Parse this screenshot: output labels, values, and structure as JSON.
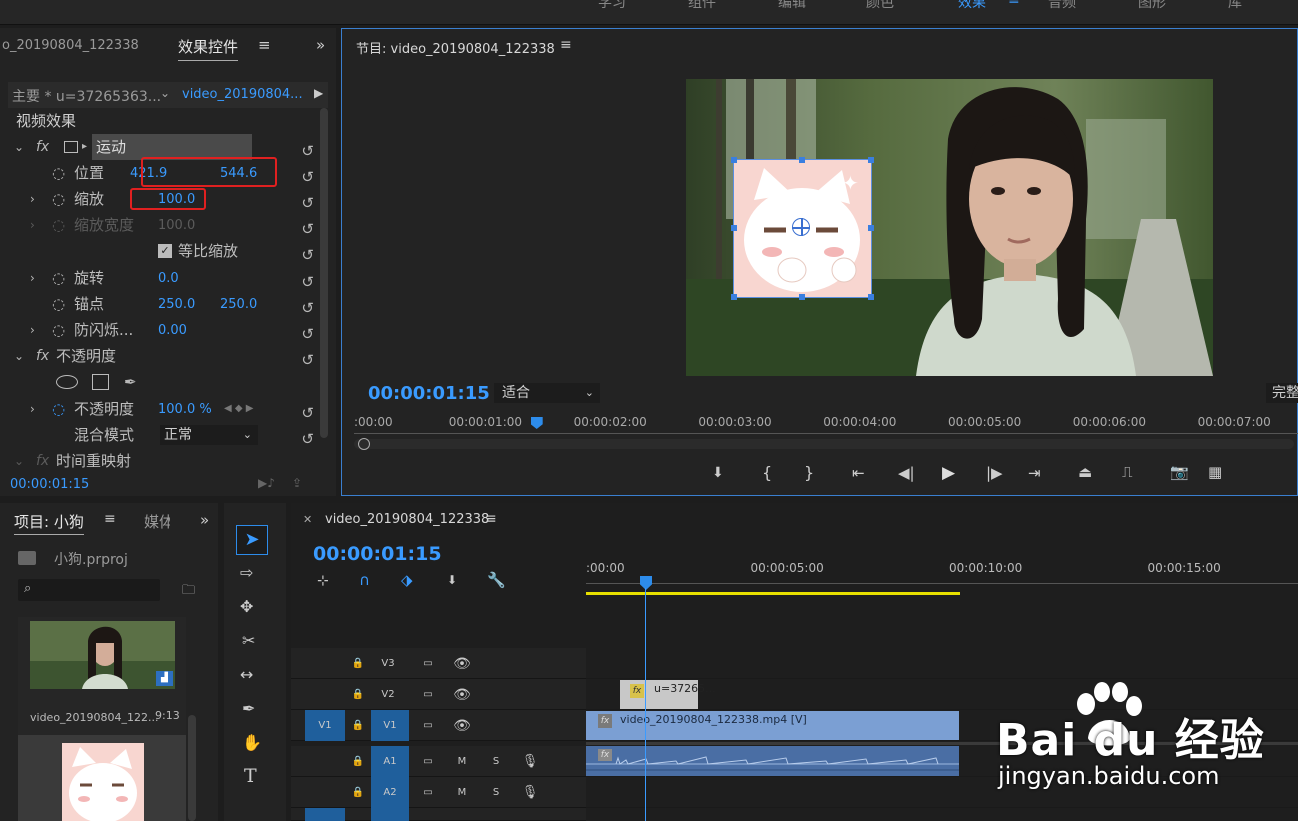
{
  "workspace_tabs": [
    "学习",
    "组件",
    "编辑",
    "颜色",
    "效果",
    "音频",
    "图形",
    "库"
  ],
  "active_workspace": "效果",
  "effect_controls": {
    "left_tab": "o_20190804_122338",
    "title": "效果控件",
    "source": "主要 * u=37265363...",
    "clip": "video_20190804...",
    "section_video": "视频效果",
    "motion": "运动",
    "position_label": "位置",
    "position_x": "421.9",
    "position_y": "544.6",
    "scale_label": "缩放",
    "scale_value": "100.0",
    "scale_width_label": "缩放宽度",
    "scale_width_value": "100.0",
    "uniform_label": "等比缩放",
    "rotation_label": "旋转",
    "rotation_value": "0.0",
    "anchor_label": "锚点",
    "anchor_x": "250.0",
    "anchor_y": "250.0",
    "flicker_label": "防闪烁...",
    "flicker_value": "0.00",
    "opacity_section": "不透明度",
    "opacity_label": "不透明度",
    "opacity_value": "100.0 %",
    "blend_label": "混合模式",
    "blend_value": "正常",
    "time_remap": "时间重映射",
    "timecode": "00:00:01:15"
  },
  "program": {
    "title": "节目: video_20190804_122338",
    "timecode": "00:00:01:15",
    "fit": "适合",
    "quality": "完整",
    "ruler": ":00:00|00:00:01:00|00:00:02:00|00:00:03:00|00:00:04:00|00:00:05:00|00:00:06:00|00:00:07:00",
    "playhead_fraction": 0.21
  },
  "project": {
    "title": "项目: 小狗",
    "media_tab": "媒体",
    "file": "小狗.prproj",
    "clip1_name": "video_20190804_122...",
    "clip1_duration": "9:13"
  },
  "timeline": {
    "title": "video_20190804_122338",
    "timecode": "00:00:01:15",
    "ruler": ":00:00|00:00:05:00|00:00:10:00|00:00:15:00",
    "tracks": [
      "V3",
      "V2",
      "V1",
      "A1",
      "A2"
    ],
    "source_v1": "V1",
    "clip_v2": "u=37265...",
    "clip_v1": "video_20190804_122338.mp4 [V]",
    "mute": "M",
    "solo": "S"
  },
  "watermark": {
    "brand": "Bai du 经验",
    "url": "jingyan.baidu.com"
  },
  "colors": {
    "accent": "#2d8ceb",
    "highlight": "#e02020",
    "clip_blue": "#7b9fd3",
    "work_area": "#e8e000"
  }
}
